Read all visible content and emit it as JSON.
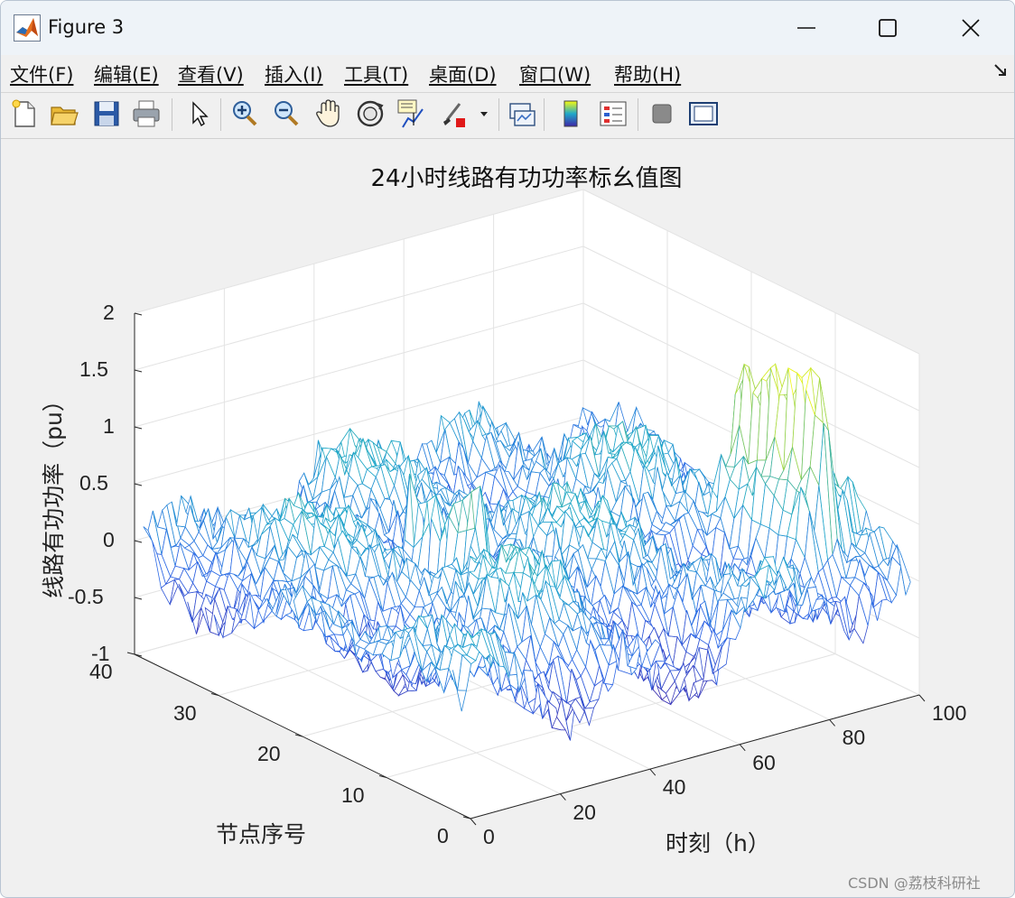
{
  "window": {
    "title": "Figure 3",
    "controls": [
      "minimize",
      "maximize",
      "close"
    ]
  },
  "menubar": {
    "items": [
      "文件(F)",
      "编辑(E)",
      "查看(V)",
      "插入(I)",
      "工具(T)",
      "桌面(D)",
      "窗口(W)",
      "帮助(H)"
    ]
  },
  "toolbar": {
    "buttons": [
      {
        "icon": "new-figure-icon"
      },
      {
        "icon": "open-folder-icon"
      },
      {
        "icon": "save-icon"
      },
      {
        "icon": "print-icon"
      },
      {
        "icon": "pointer-icon"
      },
      {
        "icon": "zoom-in-icon"
      },
      {
        "icon": "zoom-out-icon"
      },
      {
        "icon": "pan-hand-icon"
      },
      {
        "icon": "rotate-3d-icon"
      },
      {
        "icon": "data-cursor-icon"
      },
      {
        "icon": "brush-icon"
      },
      {
        "icon": "link-plot-icon"
      },
      {
        "icon": "colorbar-icon"
      },
      {
        "icon": "legend-icon"
      },
      {
        "icon": "hide-plot-tools-icon"
      },
      {
        "icon": "show-plot-tools-icon"
      }
    ]
  },
  "chart_data": {
    "type": "surface-mesh",
    "title": "24小时线路有功功率标幺值图",
    "xlabel": "时刻（h）",
    "ylabel": "节点序号",
    "zlabel": "线路有功功率（pu）",
    "xlim": [
      0,
      100
    ],
    "ylim": [
      0,
      40
    ],
    "zlim": [
      -1,
      2
    ],
    "xticks": [
      "0",
      "20",
      "40",
      "60",
      "80",
      "100"
    ],
    "yticks": [
      "0",
      "10",
      "20",
      "30",
      "40"
    ],
    "zticks": [
      "-1",
      "-0.5",
      "0",
      "0.5",
      "1",
      "1.5",
      "2"
    ],
    "grid": true,
    "colormap": "parula",
    "colors": {
      "low": "#3e26a8",
      "mid": "#1fa8c9",
      "high": "#f9fb0e"
    },
    "notes_visible": "mesh surface of 96 time points by about 37 nodes, values mostly between -0.6 and 0.6 with yellow peaks near 1.5 at high time index and node ~5-15"
  },
  "watermark": "CSDN @荔枝科研社"
}
